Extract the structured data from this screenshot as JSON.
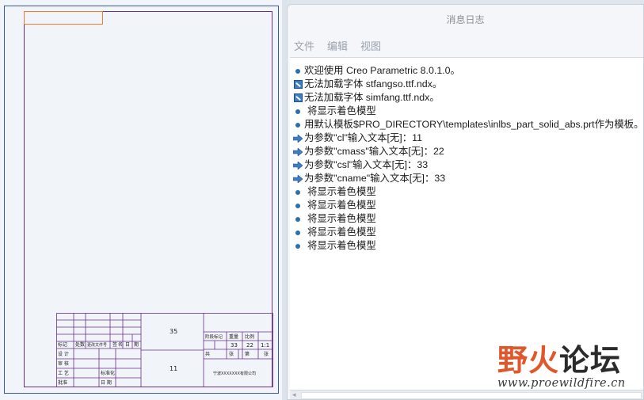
{
  "drawing": {
    "title_block": {
      "top_center": "35",
      "mid_center": "11",
      "right_values": [
        "33",
        "22",
        "1:1"
      ],
      "row_labels": [
        "标记",
        "处数",
        "更改文件号",
        "签",
        "名",
        "日",
        "期",
        "设 计",
        "审 核",
        "工 艺",
        "批准",
        "标准化",
        "日 期",
        "阶段标记",
        "重量",
        "比例",
        "共",
        "张",
        "第",
        "张"
      ],
      "company_text": "宁波XXXXXXX有限公司"
    }
  },
  "log_window": {
    "title": "消息日志",
    "menu": [
      "文件",
      "编辑",
      "视图"
    ],
    "lines": [
      {
        "icon": "info-bullet-icon",
        "text": "欢迎使用 Creo Parametric 8.0.1.0。"
      },
      {
        "icon": "warning-icon",
        "text": "无法加载字体 stfangso.ttf.ndx。"
      },
      {
        "icon": "warning-icon",
        "text": "无法加载字体 simfang.ttf.ndx。"
      },
      {
        "icon": "info-bullet-icon",
        "text": "将显示着色模型"
      },
      {
        "icon": "info-bullet-icon",
        "text": "用默认模板$PRO_DIRECTORY\\templates\\inlbs_part_solid_abs.prt作为模板。"
      },
      {
        "icon": "arrow-right-icon",
        "text": "为参数\"cl\"输入文本[无]：11"
      },
      {
        "icon": "arrow-right-icon",
        "text": "为参数\"cmass\"输入文本[无]：22"
      },
      {
        "icon": "arrow-right-icon",
        "text": "为参数\"csl\"输入文本[无]：33"
      },
      {
        "icon": "arrow-right-icon",
        "text": "为参数\"cname\"输入文本[无]：33"
      },
      {
        "icon": "info-bullet-icon",
        "text": "将显示着色模型"
      },
      {
        "icon": "info-bullet-icon",
        "text": "将显示着色模型"
      },
      {
        "icon": "info-bullet-icon",
        "text": "将显示着色模型"
      },
      {
        "icon": "info-bullet-icon",
        "text": "将显示着色模型"
      },
      {
        "icon": "info-bullet-icon",
        "text": "将显示着色模型"
      }
    ]
  },
  "watermark": {
    "name_part1": "野",
    "name_part2": "火",
    "name_part3": "论坛",
    "url": "www.proewildfire.cn"
  },
  "colors": {
    "sheet_border": "#3a5d9a",
    "drawing_lines": "#6a2f8d",
    "selection": "#ef7d2c",
    "info_bullet": "#2a6fb0",
    "watermark_accent": "#e0572c"
  }
}
